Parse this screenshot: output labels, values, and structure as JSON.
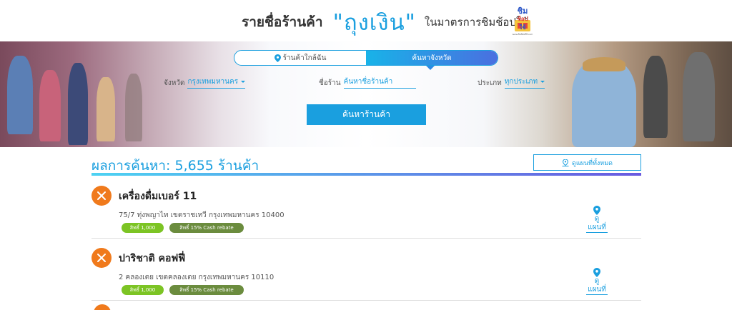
{
  "header": {
    "title_prefix": "รายชื่อร้านค้า",
    "title_brand": "\"ถุงเงิน\"",
    "title_suffix": "ในมาตรการชิมช้อปใช้",
    "logo": {
      "line1": "ชิม",
      "line2": "ช้อป",
      "line3": "ใช้",
      "tagline": "www.ชิมช้อปใช้.com"
    }
  },
  "search": {
    "tabs": [
      {
        "label": "ร้านค้าใกล้ฉัน",
        "icon": "location-pin-icon",
        "active": false
      },
      {
        "label": "ค้นหาจังหวัด",
        "active": true
      }
    ],
    "province": {
      "label": "จังหวัด",
      "value": "กรุงเทพมหานคร"
    },
    "shop_name": {
      "label": "ชื่อร้าน",
      "placeholder": "ค้นหาชื่อร้านค้า"
    },
    "type": {
      "label": "ประเภท",
      "value": "ทุกประเภท"
    },
    "button_label": "ค้นหาร้านค้า"
  },
  "results": {
    "count_text": "ผลการค้นหา: 5,655 ร้านค้า",
    "map_all_label": "ดูแผนที่ทั้งหมด",
    "items": [
      {
        "name": "เครื่องดื่มเบอร์ 11",
        "address": "75/7 ทุ่งพญาไท เขตราชเทวี กรุงเทพมหานคร 10400",
        "badges": [
          "สิทธิ์ 1,000",
          "สิทธิ์ 15% Cash rebate"
        ],
        "map_label": "ดูแผนที่",
        "category_icon": "utensils-icon"
      },
      {
        "name": "ปาริชาติ คอฟฟี่",
        "address": "2 คลองเตย เขตคลองเตย กรุงเทพมหานคร 10110",
        "badges": [
          "สิทธิ์ 1,000",
          "สิทธิ์ 15% Cash rebate"
        ],
        "map_label": "ดูแผนที่",
        "category_icon": "utensils-icon"
      }
    ]
  },
  "colors": {
    "accent": "#1a9fdf",
    "category": "#f07a1c",
    "badge_green": "#7cc424",
    "badge_olive": "#6b8c3e"
  }
}
